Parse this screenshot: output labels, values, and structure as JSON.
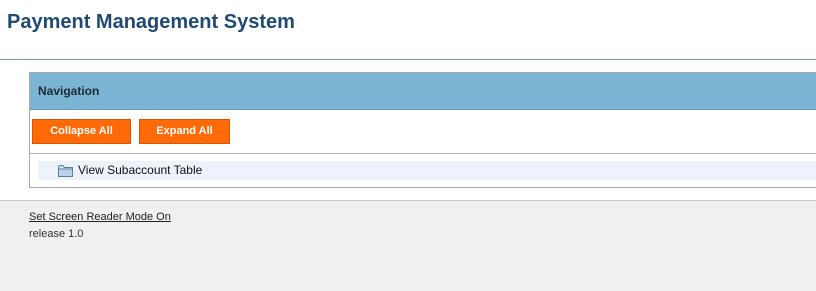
{
  "header": {
    "title": "Payment Management System"
  },
  "navigation": {
    "title": "Navigation",
    "collapse_label": "Collapse All",
    "expand_label": "Expand All",
    "tree_items": [
      {
        "label": "View Subaccount Table",
        "icon": "folder-icon"
      }
    ]
  },
  "footer": {
    "screen_reader_link": "Set Screen Reader Mode On",
    "release": "release 1.0"
  },
  "colors": {
    "title": "#1f4a73",
    "nav_header": "#7ab6d3",
    "button": "#ff6a08",
    "footer_bg": "#f0f0f0"
  }
}
